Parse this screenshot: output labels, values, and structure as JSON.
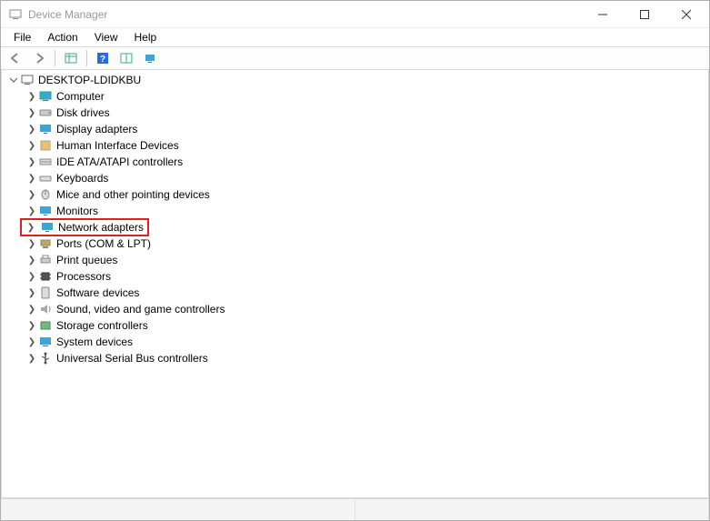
{
  "window": {
    "title": "Device Manager"
  },
  "menu": {
    "file": "File",
    "action": "Action",
    "view": "View",
    "help": "Help"
  },
  "tree": {
    "root": "DESKTOP-LDIDKBU",
    "items": {
      "computer": "Computer",
      "disk_drives": "Disk drives",
      "display_adapters": "Display adapters",
      "hid": "Human Interface Devices",
      "ide_ata": "IDE ATA/ATAPI controllers",
      "keyboards": "Keyboards",
      "mice": "Mice and other pointing devices",
      "monitors": "Monitors",
      "network_adapters": "Network adapters",
      "ports": "Ports (COM & LPT)",
      "print_queues": "Print queues",
      "processors": "Processors",
      "software_devices": "Software devices",
      "sound": "Sound, video and game controllers",
      "storage_controllers": "Storage controllers",
      "system_devices": "System devices",
      "usb": "Universal Serial Bus controllers"
    }
  },
  "highlighted_item": "network_adapters"
}
